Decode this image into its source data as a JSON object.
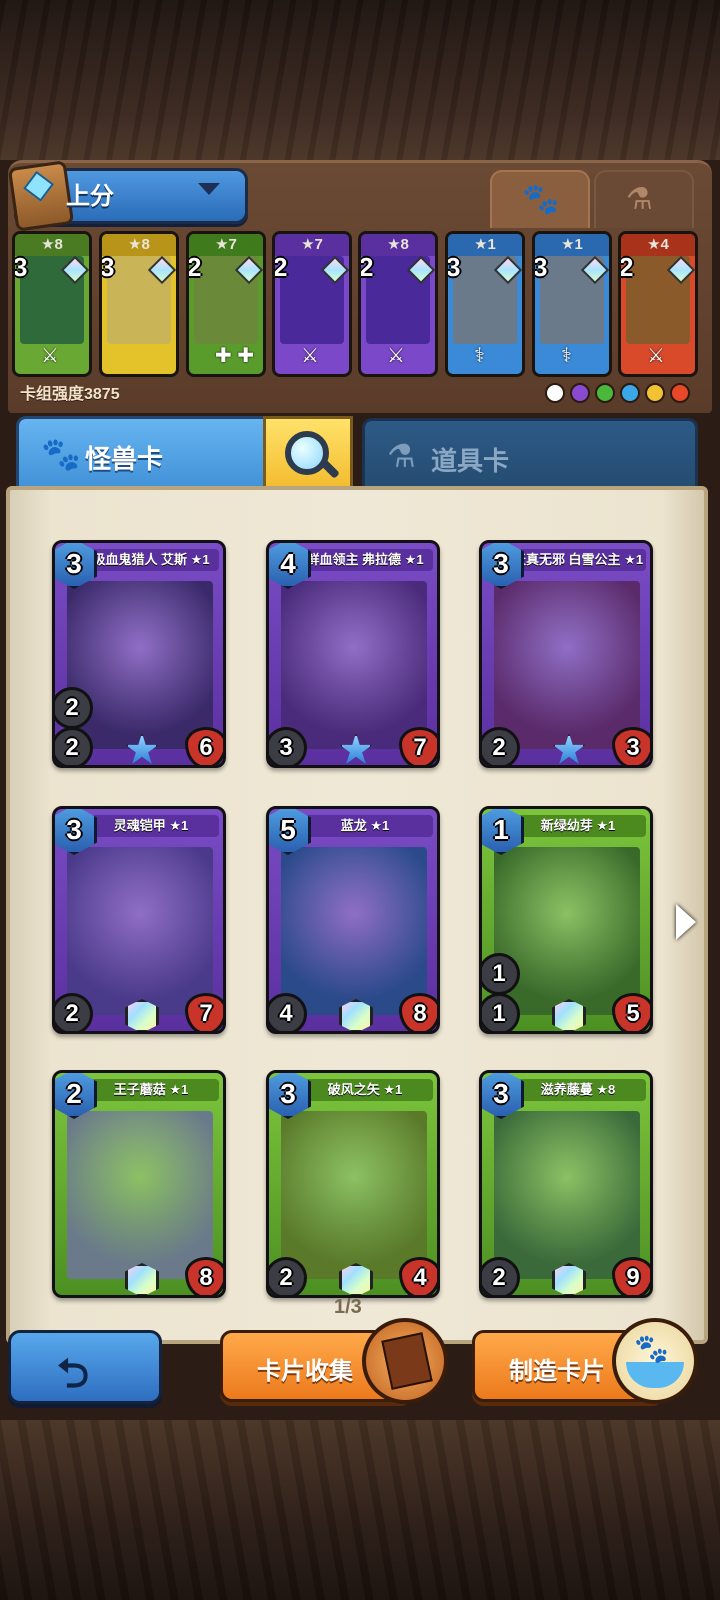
{
  "deck": {
    "name": "上分",
    "strength_label": "卡组强度3875",
    "cards": [
      {
        "stars": "★8",
        "cost": "3",
        "color": "#6aa834",
        "top": "#4a7a22",
        "art": "#2f6a3a",
        "ability": "⚔"
      },
      {
        "stars": "★8",
        "cost": "3",
        "color": "#e3c22a",
        "top": "#b89418",
        "art": "#c9b558",
        "ability": ""
      },
      {
        "stars": "★7",
        "cost": "2",
        "color": "#5a9c2c",
        "top": "#3f7a1c",
        "art": "#6a8a3a",
        "ability": "✚ ✚"
      },
      {
        "stars": "★7",
        "cost": "2",
        "color": "#7a48c8",
        "top": "#5a2fa0",
        "art": "#4a2a9a",
        "ability": "⚔"
      },
      {
        "stars": "★8",
        "cost": "2",
        "color": "#7a48c8",
        "top": "#5a2fa0",
        "art": "#4a2a9a",
        "ability": "⚔"
      },
      {
        "stars": "★1",
        "cost": "3",
        "color": "#3a8ad8",
        "top": "#2a68b0",
        "art": "#6a7a8a",
        "ability": "⚕"
      },
      {
        "stars": "★1",
        "cost": "3",
        "color": "#3a8ad8",
        "top": "#2a68b0",
        "art": "#6a7a8a",
        "ability": "⚕"
      },
      {
        "stars": "★4",
        "cost": "2",
        "color": "#d84a2a",
        "top": "#a8321a",
        "art": "#8a5a2a",
        "ability": "⚔"
      }
    ],
    "filter_colors": [
      "#ffffff",
      "#8a4ad0",
      "#4ab83a",
      "#3aa8e8",
      "#f2c232",
      "#e8482a"
    ]
  },
  "tabs": {
    "monster_icon": "paw-icon",
    "potion_icon": "flask-icon",
    "monster_label": "怪兽卡",
    "item_label": "道具卡"
  },
  "cards": [
    {
      "name": "吸血鬼猎人 艾斯 ★1",
      "cost": "3",
      "speed": "2",
      "attack": "2",
      "hp": "6",
      "theme": "purple",
      "art": "#3a2a6a",
      "rarity": "star"
    },
    {
      "name": "鲜血领主 弗拉德 ★1",
      "cost": "4",
      "speed": "",
      "attack": "3",
      "hp": "7",
      "theme": "purple",
      "art": "#4a2a7a",
      "rarity": "star"
    },
    {
      "name": "天真无邪 白雪公主 ★1",
      "cost": "3",
      "speed": "",
      "attack": "2",
      "hp": "3",
      "theme": "purple",
      "art": "#5a2a6a",
      "rarity": "star"
    },
    {
      "name": "灵魂铠甲 ★1",
      "cost": "3",
      "speed": "",
      "attack": "2",
      "hp": "7",
      "theme": "purple",
      "art": "#4a3a8a",
      "rarity": "gem"
    },
    {
      "name": "蓝龙 ★1",
      "cost": "5",
      "speed": "",
      "attack": "4",
      "hp": "8",
      "theme": "purple",
      "art": "#2a4a8a",
      "rarity": "gem"
    },
    {
      "name": "新绿幼芽 ★1",
      "cost": "1",
      "speed": "1",
      "attack": "1",
      "hp": "5",
      "theme": "green",
      "art": "#3a6a2a",
      "rarity": "gem"
    },
    {
      "name": "王子蘑菇 ★1",
      "cost": "2",
      "speed": "",
      "attack": "",
      "hp": "8",
      "theme": "green",
      "art": "#6a7a8a",
      "rarity": "gem"
    },
    {
      "name": "破风之矢 ★1",
      "cost": "3",
      "speed": "",
      "attack": "2",
      "hp": "4",
      "theme": "green",
      "art": "#5a7a2a",
      "rarity": "gem"
    },
    {
      "name": "滋养藤蔓 ★8",
      "cost": "3",
      "speed": "",
      "attack": "2",
      "hp": "9",
      "theme": "green",
      "art": "#3a6a3a",
      "rarity": "gem"
    }
  ],
  "pager": {
    "page": "1/3"
  },
  "buttons": {
    "back_icon": "back-arrow-icon",
    "collect_label": "卡片收集",
    "craft_label": "制造卡片"
  }
}
